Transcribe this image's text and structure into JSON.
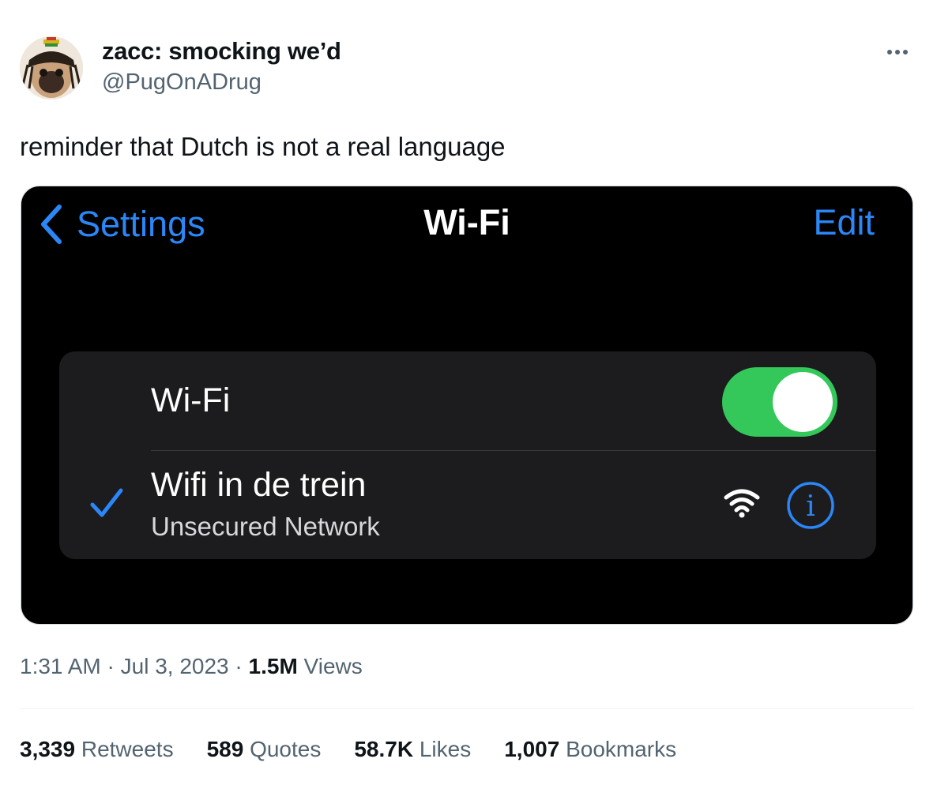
{
  "author": {
    "name": "zacc: smocking we’d",
    "handle": "@PugOnADrug"
  },
  "tweet": {
    "text": "reminder that Dutch is not a real language"
  },
  "media": {
    "back_label": "Settings",
    "title": "Wi-Fi",
    "edit_label": "Edit",
    "wifi_row_label": "Wi-Fi",
    "wifi_enabled": true,
    "network_name": "Wifi in de trein",
    "network_status": "Unsecured Network",
    "info_icon": "i",
    "accent_color": "#2b87f7",
    "toggle_color": "#34c759"
  },
  "meta": {
    "time": "1:31 AM",
    "separator": "·",
    "date": "Jul 3, 2023",
    "views_count": "1.5M",
    "views_label": "Views"
  },
  "stats": [
    {
      "count": "3,339",
      "label": "Retweets"
    },
    {
      "count": "589",
      "label": "Quotes"
    },
    {
      "count": "58.7K",
      "label": "Likes"
    },
    {
      "count": "1,007",
      "label": "Bookmarks"
    }
  ]
}
